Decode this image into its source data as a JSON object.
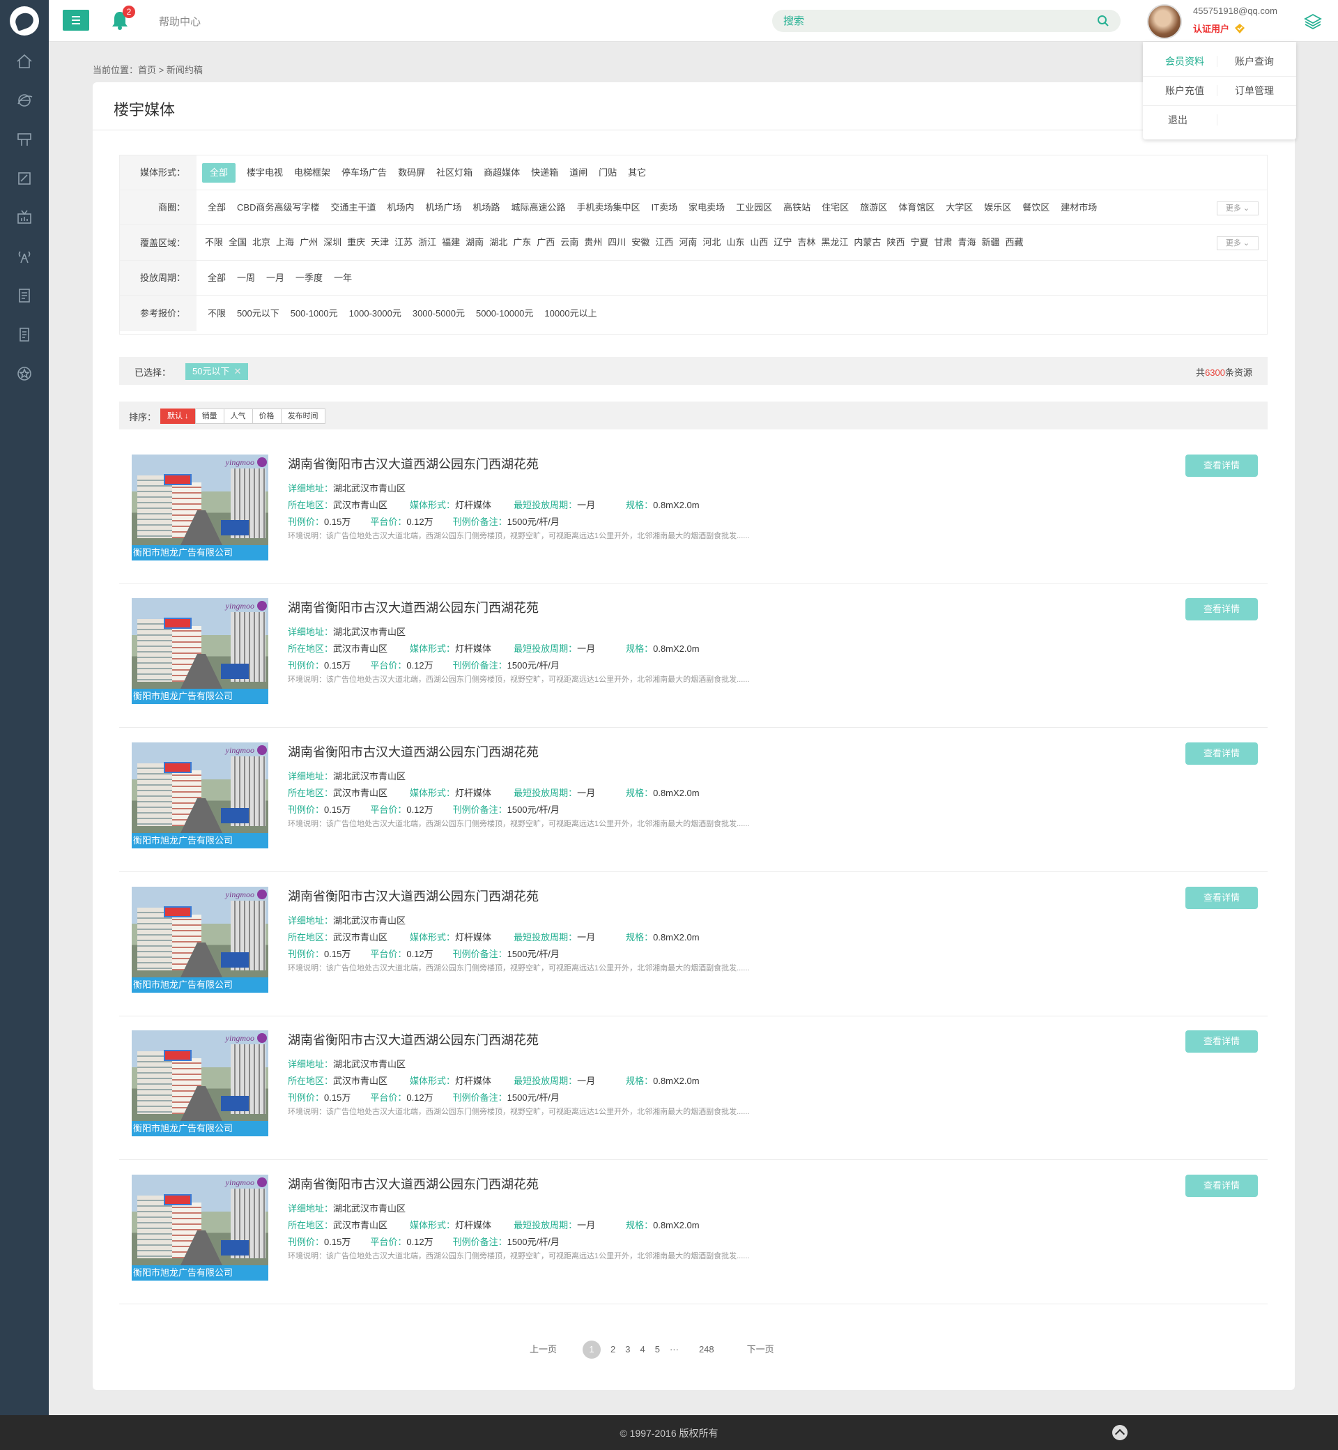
{
  "header": {
    "help_label": "帮助中心",
    "bell_count": "2",
    "search_placeholder": "搜索",
    "user_email": "455751918@qq.com",
    "user_status": "认证用户",
    "accent_color": "#25b092"
  },
  "dropdown": {
    "items": [
      "会员资料",
      "账户查询",
      "账户充值",
      "订单管理",
      "退出"
    ]
  },
  "breadcrumb": "当前位置：首页 > 新闻约稿",
  "page_title": "楼宇媒体",
  "filters": [
    {
      "label": "媒体形式：",
      "options": [
        "全部",
        "楼宇电视",
        "电梯框架",
        "停车场广告",
        "数码屏",
        "社区灯箱",
        "商超媒体",
        "快递箱",
        "道闸",
        "门贴",
        "其它"
      ],
      "more": ""
    },
    {
      "label": "商圈：",
      "options": [
        "全部",
        "CBD商务高级写字楼",
        "交通主干道",
        "机场内",
        "机场广场",
        "机场路",
        "城际高速公路",
        "手机卖场集中区",
        "IT卖场",
        "家电卖场",
        "工业园区",
        "高铁站",
        "住宅区",
        "旅游区",
        "体育馆区",
        "大学区",
        "娱乐区",
        "餐饮区",
        "建材市场"
      ],
      "more": "更多"
    },
    {
      "label": "覆盖区域：",
      "options": [
        "不限",
        "全国",
        "北京",
        "上海",
        "广州",
        "深圳",
        "重庆",
        "天津",
        "江苏",
        "浙江",
        "福建",
        "湖南",
        "湖北",
        "广东",
        "广西",
        "云南",
        "贵州",
        "四川",
        "安徽",
        "江西",
        "河南",
        "河北",
        "山东",
        "山西",
        "辽宁",
        "吉林",
        "黑龙江",
        "内蒙古",
        "陕西",
        "宁夏",
        "甘肃",
        "青海",
        "新疆",
        "西藏"
      ],
      "more": "更多"
    },
    {
      "label": "投放周期：",
      "options": [
        "全部",
        "一周",
        "一月",
        "一季度",
        "一年"
      ],
      "more": ""
    },
    {
      "label": "参考报价：",
      "options": [
        "不限",
        "500元以下",
        "500-1000元",
        "1000-3000元",
        "3000-5000元",
        "5000-10000元",
        "10000元以上"
      ],
      "more": ""
    }
  ],
  "selected": {
    "label": "已选择：",
    "tag": "50元以下",
    "count_prefix": "共",
    "count": "6300",
    "count_suffix": "条资源"
  },
  "sort": {
    "label": "排序：",
    "options": [
      "默认 ↓",
      "销量",
      "人气",
      "价格",
      "发布时间"
    ]
  },
  "listing": {
    "title": "湖南省衡阳市古汉大道西湖公园东门西湖花苑",
    "address_k": "详细地址：",
    "address_v": "湖北武汉市青山区",
    "region_k": "所在地区：",
    "region_v": "武汉市青山区",
    "form_k": "媒体形式：",
    "form_v": "灯杆媒体",
    "period_k": "最短投放周期：",
    "period_v": "一月",
    "spec_k": "规格：",
    "spec_v": "0.8mX2.0m",
    "price_k": "刊例价：",
    "price_v": "0.15万",
    "platform_k": "平台价：",
    "platform_v": "0.12万",
    "note_k": "刊例价备注：",
    "note_v": "1500元/杆/月",
    "desc": "环境说明：该广告位地处古汉大道北端，西湖公园东门侧旁楼顶，视野空旷，可视距离远达1公里开外，北邻湘南最大的烟酒副食批发......",
    "company": "衡阳市旭龙广告有限公司",
    "brand": "yingmoo",
    "button": "查看详情"
  },
  "items_count": 6,
  "pagination": {
    "prev": "上一页",
    "pages": [
      "1",
      "2",
      "3",
      "4",
      "5",
      "···",
      "248"
    ],
    "next": "下一页"
  },
  "footer": "© 1997-2016 版权所有"
}
